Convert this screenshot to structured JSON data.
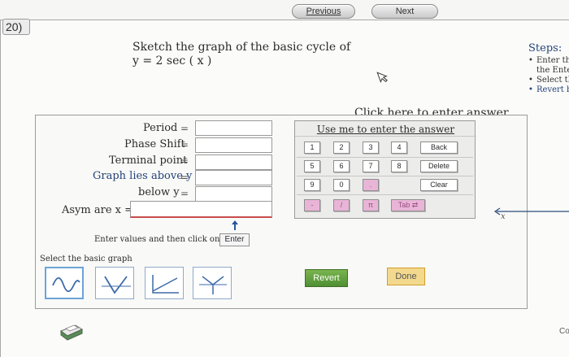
{
  "nav": {
    "previous_label": "Previous",
    "next_label": "Next"
  },
  "question": {
    "number": "20)",
    "prompt_line1": "Sketch the graph of the basic cycle of",
    "prompt_line2": "y  =  2 sec ( x )"
  },
  "link": {
    "click_here": "Click here to enter answer"
  },
  "steps": {
    "title": "Steps:",
    "items": [
      "Enter the",
      "Select th",
      "Revert b"
    ],
    "sub": "the Ente"
  },
  "form": {
    "period_label": "Period",
    "phase_label": "Phase Shift",
    "terminal_label": "Terminal point",
    "above_label": "Graph lies above y",
    "below_label": "below y",
    "asym_label": "Asym  are x  =",
    "eq": "=",
    "enter_note": "Enter values and then click on",
    "enter_arrow": "→",
    "enter_button": "Enter",
    "select_label": "Select the basic graph"
  },
  "keyboard": {
    "title": "Use me to enter the answer",
    "keys_row1": [
      "1",
      "2",
      "3",
      "4"
    ],
    "keys_row2": [
      "5",
      "6",
      "7",
      "8"
    ],
    "keys_row3": [
      "9",
      "0",
      "."
    ],
    "back": "Back",
    "delete": "Delete",
    "clear": "Clear",
    "keys_row4": [
      "-",
      "/",
      "π",
      "Tab ⇄"
    ],
    "key_colors": {
      "pink": "#e9b5d7"
    }
  },
  "buttons": {
    "revert": "Revert",
    "done": "Done"
  },
  "axis_label": "x",
  "corner_text": "Co",
  "icons": [
    "cursor-icon",
    "printer-icon",
    "sine-graph-icon",
    "v-graph-icon",
    "angle-graph-icon",
    "y-graph-icon",
    "up-arrow-icon",
    "axis-arrow-icon"
  ]
}
